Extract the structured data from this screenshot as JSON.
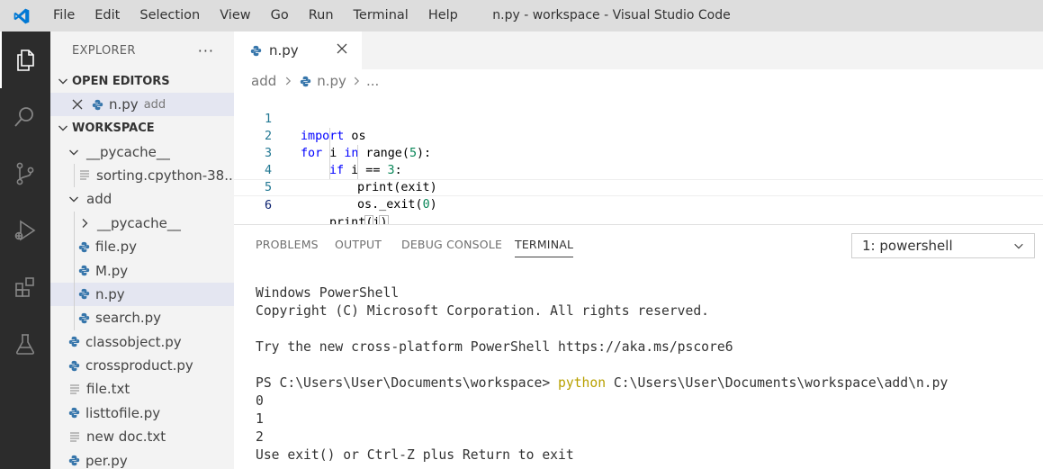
{
  "titlebar": {
    "menu": [
      "File",
      "Edit",
      "Selection",
      "View",
      "Go",
      "Run",
      "Terminal",
      "Help"
    ],
    "window_title": "n.py - workspace - Visual Studio Code"
  },
  "activitybar": {
    "icons": [
      "explorer-icon",
      "search-icon",
      "source-control-icon",
      "run-debug-icon",
      "extensions-icon",
      "testing-icon"
    ]
  },
  "sidebar": {
    "title": "EXPLORER",
    "more": "···",
    "open_editors": {
      "label": "OPEN EDITORS",
      "items": [
        {
          "name": "n.py",
          "folder": "add"
        }
      ]
    },
    "workspace": {
      "label": "WORKSPACE",
      "tree": [
        {
          "label": "__pycache__",
          "type": "folder-open"
        },
        {
          "label": "sorting.cpython-38....",
          "type": "file"
        },
        {
          "label": "add",
          "type": "folder-open"
        },
        {
          "label": "__pycache__",
          "type": "folder-closed"
        },
        {
          "label": "file.py",
          "type": "py"
        },
        {
          "label": "M.py",
          "type": "py"
        },
        {
          "label": "n.py",
          "type": "py"
        },
        {
          "label": "search.py",
          "type": "py"
        },
        {
          "label": "classobject.py",
          "type": "py"
        },
        {
          "label": "crossproduct.py",
          "type": "py"
        },
        {
          "label": "file.txt",
          "type": "txt"
        },
        {
          "label": "listtofile.py",
          "type": "py"
        },
        {
          "label": "new doc.txt",
          "type": "txt"
        },
        {
          "label": "per.py",
          "type": "py"
        }
      ]
    }
  },
  "editor": {
    "tab": "n.py",
    "breadcrumb": [
      "add",
      "n.py",
      "..."
    ],
    "lines": [
      "1",
      "2",
      "3",
      "4",
      "5",
      "6"
    ],
    "code": {
      "l1_kw": "import",
      "l1_rest": " os",
      "l2_kw": "for",
      "l2_a": " i ",
      "l2_kw2": "in",
      "l2_b": " range(",
      "l2_num": "5",
      "l2_c": "):",
      "l3_kw": "if",
      "l3_a": " i == ",
      "l3_num": "3",
      "l3_b": ":",
      "l4": "print(exit)",
      "l5_a": "os._exit(",
      "l5_num": "0",
      "l5_b": ")",
      "l6_a": "print",
      "l6_b": "(",
      "l6_c": "i",
      "l6_d": ")"
    }
  },
  "panel": {
    "tabs": [
      "PROBLEMS",
      "OUTPUT",
      "DEBUG CONSOLE",
      "TERMINAL"
    ],
    "terminal_select": "1: powershell",
    "terminal": {
      "l1": "Windows PowerShell",
      "l2": "Copyright (C) Microsoft Corporation. All rights reserved.",
      "l3": "Try the new cross-platform PowerShell https://aka.ms/pscore6",
      "prompt": "PS C:\\Users\\User\\Documents\\workspace> ",
      "cmd": "python",
      "args": " C:\\Users\\User\\Documents\\workspace\\add\\n.py",
      "o1": "0",
      "o2": "1",
      "o3": "2",
      "o4": "Use exit() or Ctrl-Z plus Return to exit"
    }
  },
  "colors": {
    "activitybar": "#2c2c2c",
    "sidebar": "#f3f3f3",
    "python_icon": "#3776ab",
    "accent": "#007acc"
  }
}
